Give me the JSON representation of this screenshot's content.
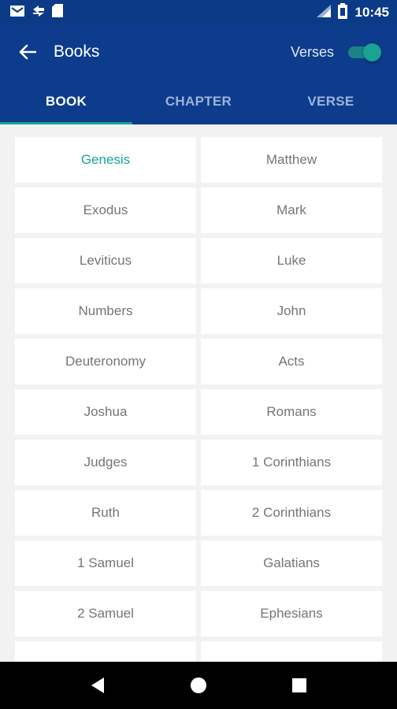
{
  "status_bar": {
    "time": "10:45",
    "left_icons": [
      "gmail-icon",
      "sync-icon",
      "sd-card-icon"
    ],
    "right_icons": [
      "signal-icon",
      "battery-icon"
    ]
  },
  "app_bar": {
    "title": "Books",
    "toggle_label": "Verses",
    "toggle_on": true
  },
  "tabs": [
    {
      "label": "BOOK",
      "active": true
    },
    {
      "label": "CHAPTER",
      "active": false
    },
    {
      "label": "VERSE",
      "active": false
    }
  ],
  "books": {
    "selected": "Genesis",
    "rows": [
      [
        "Genesis",
        "Matthew"
      ],
      [
        "Exodus",
        "Mark"
      ],
      [
        "Leviticus",
        "Luke"
      ],
      [
        "Numbers",
        "John"
      ],
      [
        "Deuteronomy",
        "Acts"
      ],
      [
        "Joshua",
        "Romans"
      ],
      [
        "Judges",
        "1 Corinthians"
      ],
      [
        "Ruth",
        "2 Corinthians"
      ],
      [
        "1 Samuel",
        "Galatians"
      ],
      [
        "2 Samuel",
        "Ephesians"
      ],
      [
        "",
        ""
      ]
    ]
  },
  "colors": {
    "primary": "#0d3c8c",
    "accent": "#1aa392",
    "background": "#f2f2f2"
  },
  "nav_bar": {
    "buttons": [
      "back-triangle-icon",
      "home-circle-icon",
      "recents-square-icon"
    ]
  }
}
